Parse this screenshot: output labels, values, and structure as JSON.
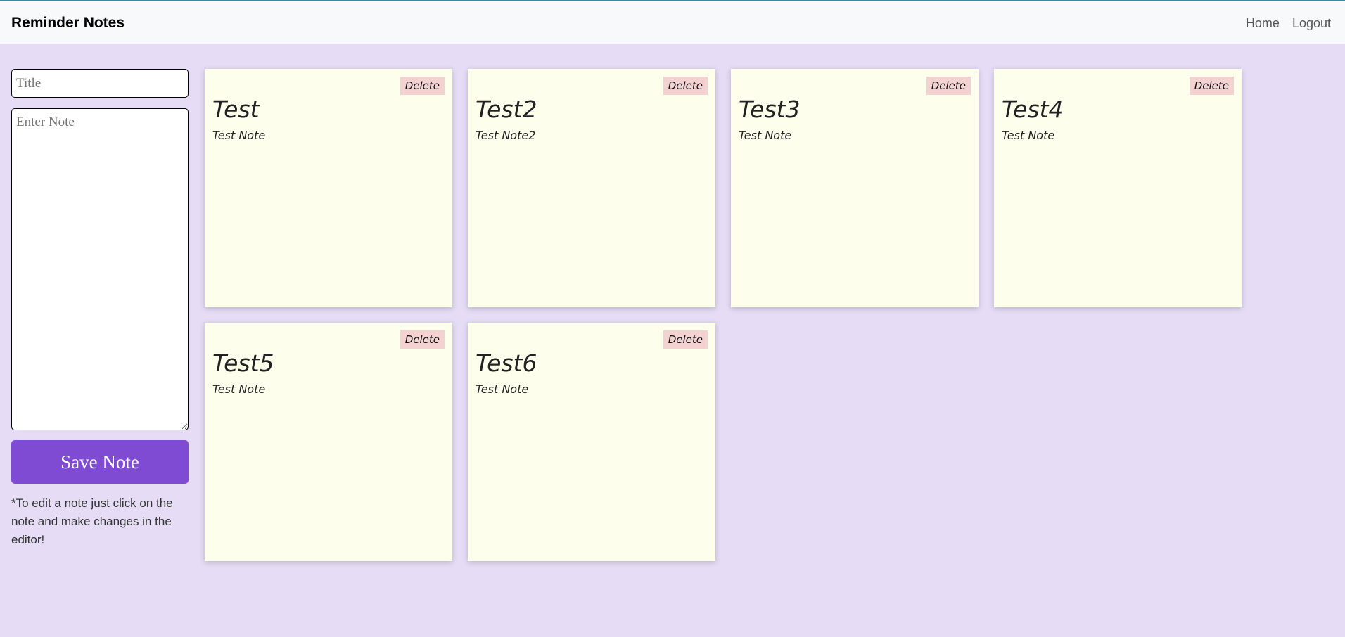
{
  "navbar": {
    "brand": "Reminder Notes",
    "links": [
      "Home",
      "Logout"
    ]
  },
  "editor": {
    "title_placeholder": "Title",
    "note_placeholder": "Enter Note",
    "save_label": "Save Note",
    "hint": "*To edit a note just click on the note and make changes in the editor!"
  },
  "notes": [
    {
      "title": "Test",
      "body": "Test Note",
      "delete_label": "Delete"
    },
    {
      "title": "Test2",
      "body": "Test Note2",
      "delete_label": "Delete"
    },
    {
      "title": "Test3",
      "body": "Test Note",
      "delete_label": "Delete"
    },
    {
      "title": "Test4",
      "body": "Test Note",
      "delete_label": "Delete"
    },
    {
      "title": "Test5",
      "body": "Test Note",
      "delete_label": "Delete"
    },
    {
      "title": "Test6",
      "body": "Test Note",
      "delete_label": "Delete"
    }
  ]
}
